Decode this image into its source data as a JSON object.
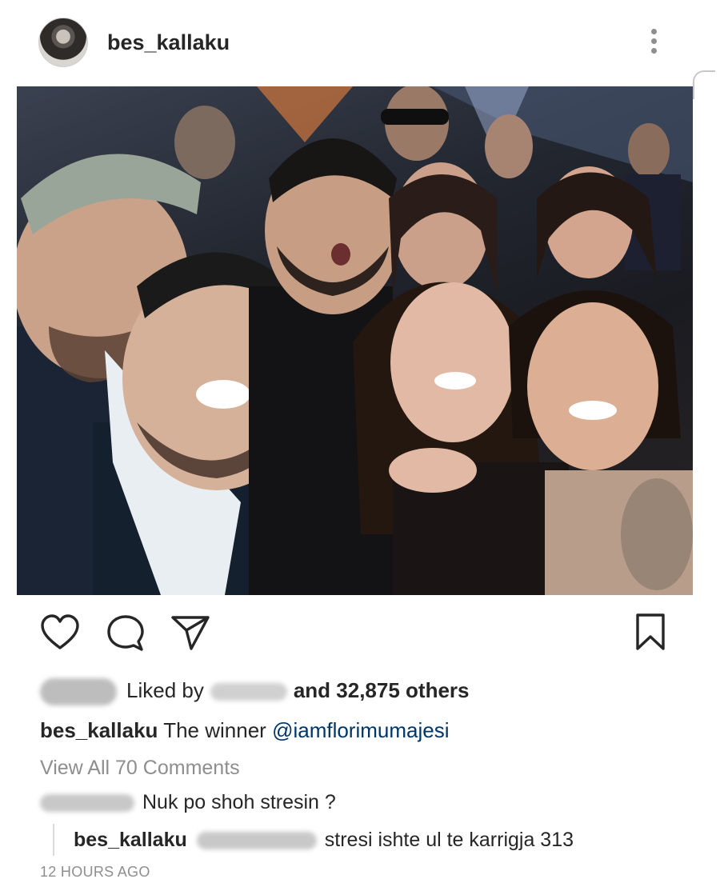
{
  "post": {
    "username": "bes_kallaku",
    "liked_by_prefix": "Liked by",
    "liked_by_suffix": "and 32,875 others",
    "caption_user": "bes_kallaku",
    "caption_text": "The winner",
    "caption_mention": "@iamflorimumajesi",
    "view_all_comments": "View All 70 Comments",
    "timestamp": "12 HOURS AGO"
  },
  "comments": [
    {
      "text": "Nuk po shoh stresin ?"
    }
  ],
  "replies": [
    {
      "username": "bes_kallaku",
      "text": "stresi ishte ul te karrigja 313"
    }
  ],
  "icons": {
    "more": "more-vertical-icon",
    "like": "heart-icon",
    "comment": "comment-bubble-icon",
    "share": "paper-plane-icon",
    "save": "bookmark-icon"
  },
  "colors": {
    "text": "#262626",
    "muted": "#8e8e8e",
    "mention": "#003569"
  }
}
